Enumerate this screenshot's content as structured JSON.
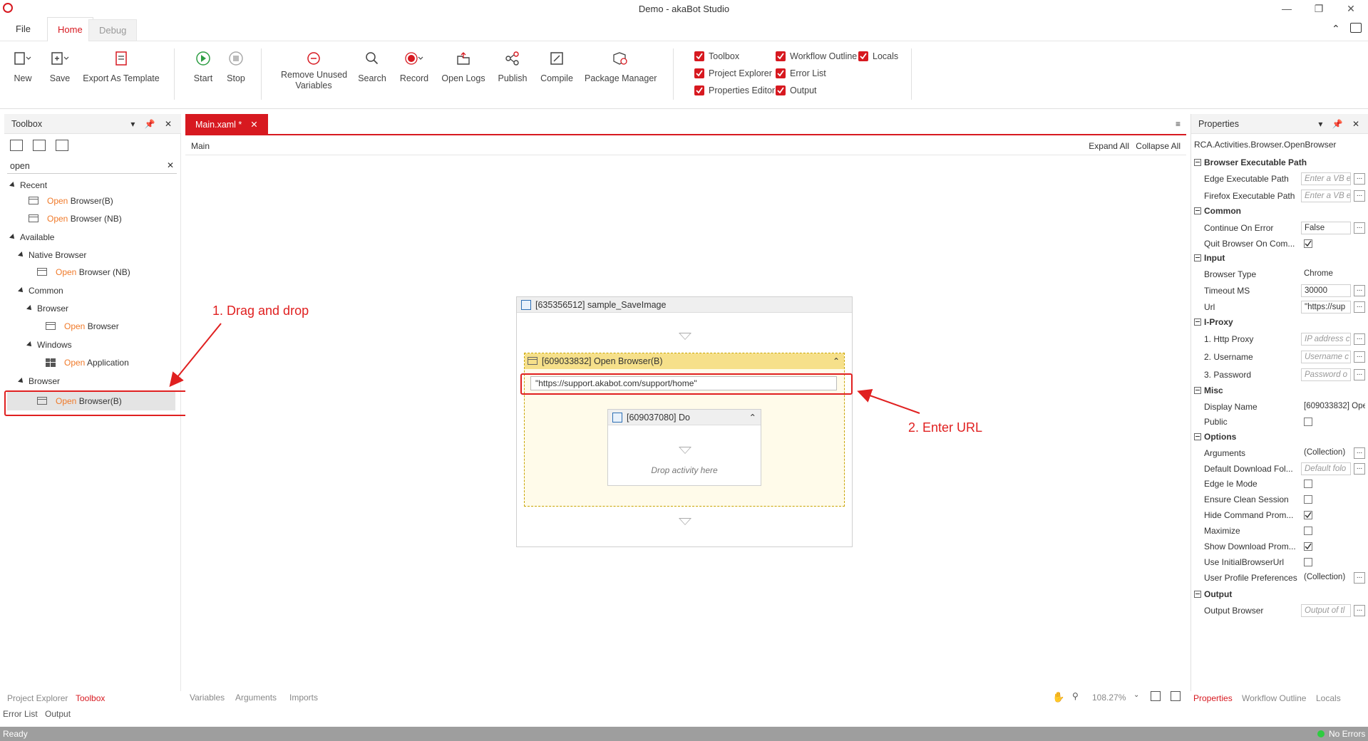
{
  "window": {
    "title": "Demo - akaBot Studio"
  },
  "menu_tabs": {
    "file": "File",
    "home": "Home",
    "debug": "Debug"
  },
  "ribbon": {
    "new": "New",
    "save": "Save",
    "export": "Export As Template",
    "start": "Start",
    "stop": "Stop",
    "remove_unused_1": "Remove Unused",
    "remove_unused_2": "Variables",
    "search": "Search",
    "record": "Record",
    "open_logs": "Open Logs",
    "publish": "Publish",
    "compile": "Compile",
    "package_manager": "Package Manager",
    "checks": {
      "toolbox": "Toolbox",
      "project_explorer": "Project Explorer",
      "properties_editor": "Properties Editor",
      "workflow_outline": "Workflow Outline",
      "error_list": "Error List",
      "output": "Output",
      "locals": "Locals"
    }
  },
  "toolbox": {
    "title": "Toolbox",
    "search_value": "open",
    "recent": "Recent",
    "recent_items": [
      {
        "hl": "Open",
        "rest": " Browser(B)"
      },
      {
        "hl": "Open",
        "rest": " Browser (NB)"
      }
    ],
    "available": "Available",
    "native_browser": "Native Browser",
    "native_item": {
      "hl": "Open",
      "rest": " Browser (NB)"
    },
    "common": "Common",
    "browser": "Browser",
    "browser_item": {
      "hl": "Open",
      "rest": " Browser"
    },
    "windows": "Windows",
    "windows_item": {
      "hl": "Open",
      "rest": " Application"
    },
    "browser2": "Browser",
    "browser2_item": {
      "hl": "Open",
      "rest": " Browser(B)"
    }
  },
  "document": {
    "tab": "Main.xaml *",
    "breadcrumb": "Main",
    "expand_all": "Expand All",
    "collapse_all": "Collapse All",
    "sequence_title": "[635356512] sample_SaveImage",
    "open_browser_title": "[609033832] Open Browser(B)",
    "url_value": "\"https://support.akabot.com/support/home\"",
    "do_title": "[609037080] Do",
    "drop_hint": "Drop activity here"
  },
  "annotations": {
    "step1": "1. Drag and drop",
    "step2": "2. Enter URL"
  },
  "properties": {
    "title": "Properties",
    "activity_type": "RCA.Activities.Browser.OpenBrowser",
    "cat_browser_exec": "Browser Executable Path",
    "edge_path": "Edge Executable Path",
    "edge_path_ph": "Enter a VB e",
    "firefox_path": "Firefox Executable Path",
    "firefox_path_ph": "Enter a VB e",
    "cat_common": "Common",
    "continue_on_error": "Continue On Error",
    "continue_on_error_val": "False",
    "quit_browser": "Quit Browser On Com...",
    "cat_input": "Input",
    "browser_type": "Browser Type",
    "browser_type_val": "Chrome",
    "timeout": "Timeout MS",
    "timeout_val": "30000",
    "url": "Url",
    "url_val": "\"https://sup",
    "cat_proxy": "I-Proxy",
    "http_proxy": "1. Http Proxy",
    "http_proxy_ph": "IP address c",
    "username": "2. Username",
    "username_ph": "Username c",
    "password": "3. Password",
    "password_ph": "Password o",
    "cat_misc": "Misc",
    "display_name": "Display Name",
    "display_name_val": "[609033832] Ope",
    "public": "Public",
    "cat_options": "Options",
    "arguments": "Arguments",
    "arguments_val": "(Collection)",
    "default_download": "Default Download Fol...",
    "default_download_ph": "Default folo",
    "edge_ie_mode": "Edge Ie Mode",
    "ensure_clean": "Ensure Clean Session",
    "hide_command": "Hide Command Prom...",
    "maximize": "Maximize",
    "show_download": "Show Download Prom...",
    "use_initial_url": "Use InitialBrowserUrl",
    "user_profile": "User Profile Preferences",
    "user_profile_val": "(Collection)",
    "cat_output": "Output",
    "output_browser": "Output Browser",
    "output_browser_ph": "Output of tl"
  },
  "bottom": {
    "left_tabs": [
      "Project Explorer",
      "Toolbox",
      "Error List",
      "Output"
    ],
    "center_tabs": [
      "Variables",
      "Arguments",
      "Imports"
    ],
    "zoom": "108.27%",
    "right_tabs": [
      "Properties",
      "Workflow Outline",
      "Locals"
    ]
  },
  "status": {
    "left": "Ready",
    "right": "No Errors"
  },
  "colors": {
    "accent": "#d71920",
    "highlight": "#f07a2a",
    "annotation": "#e02020"
  }
}
